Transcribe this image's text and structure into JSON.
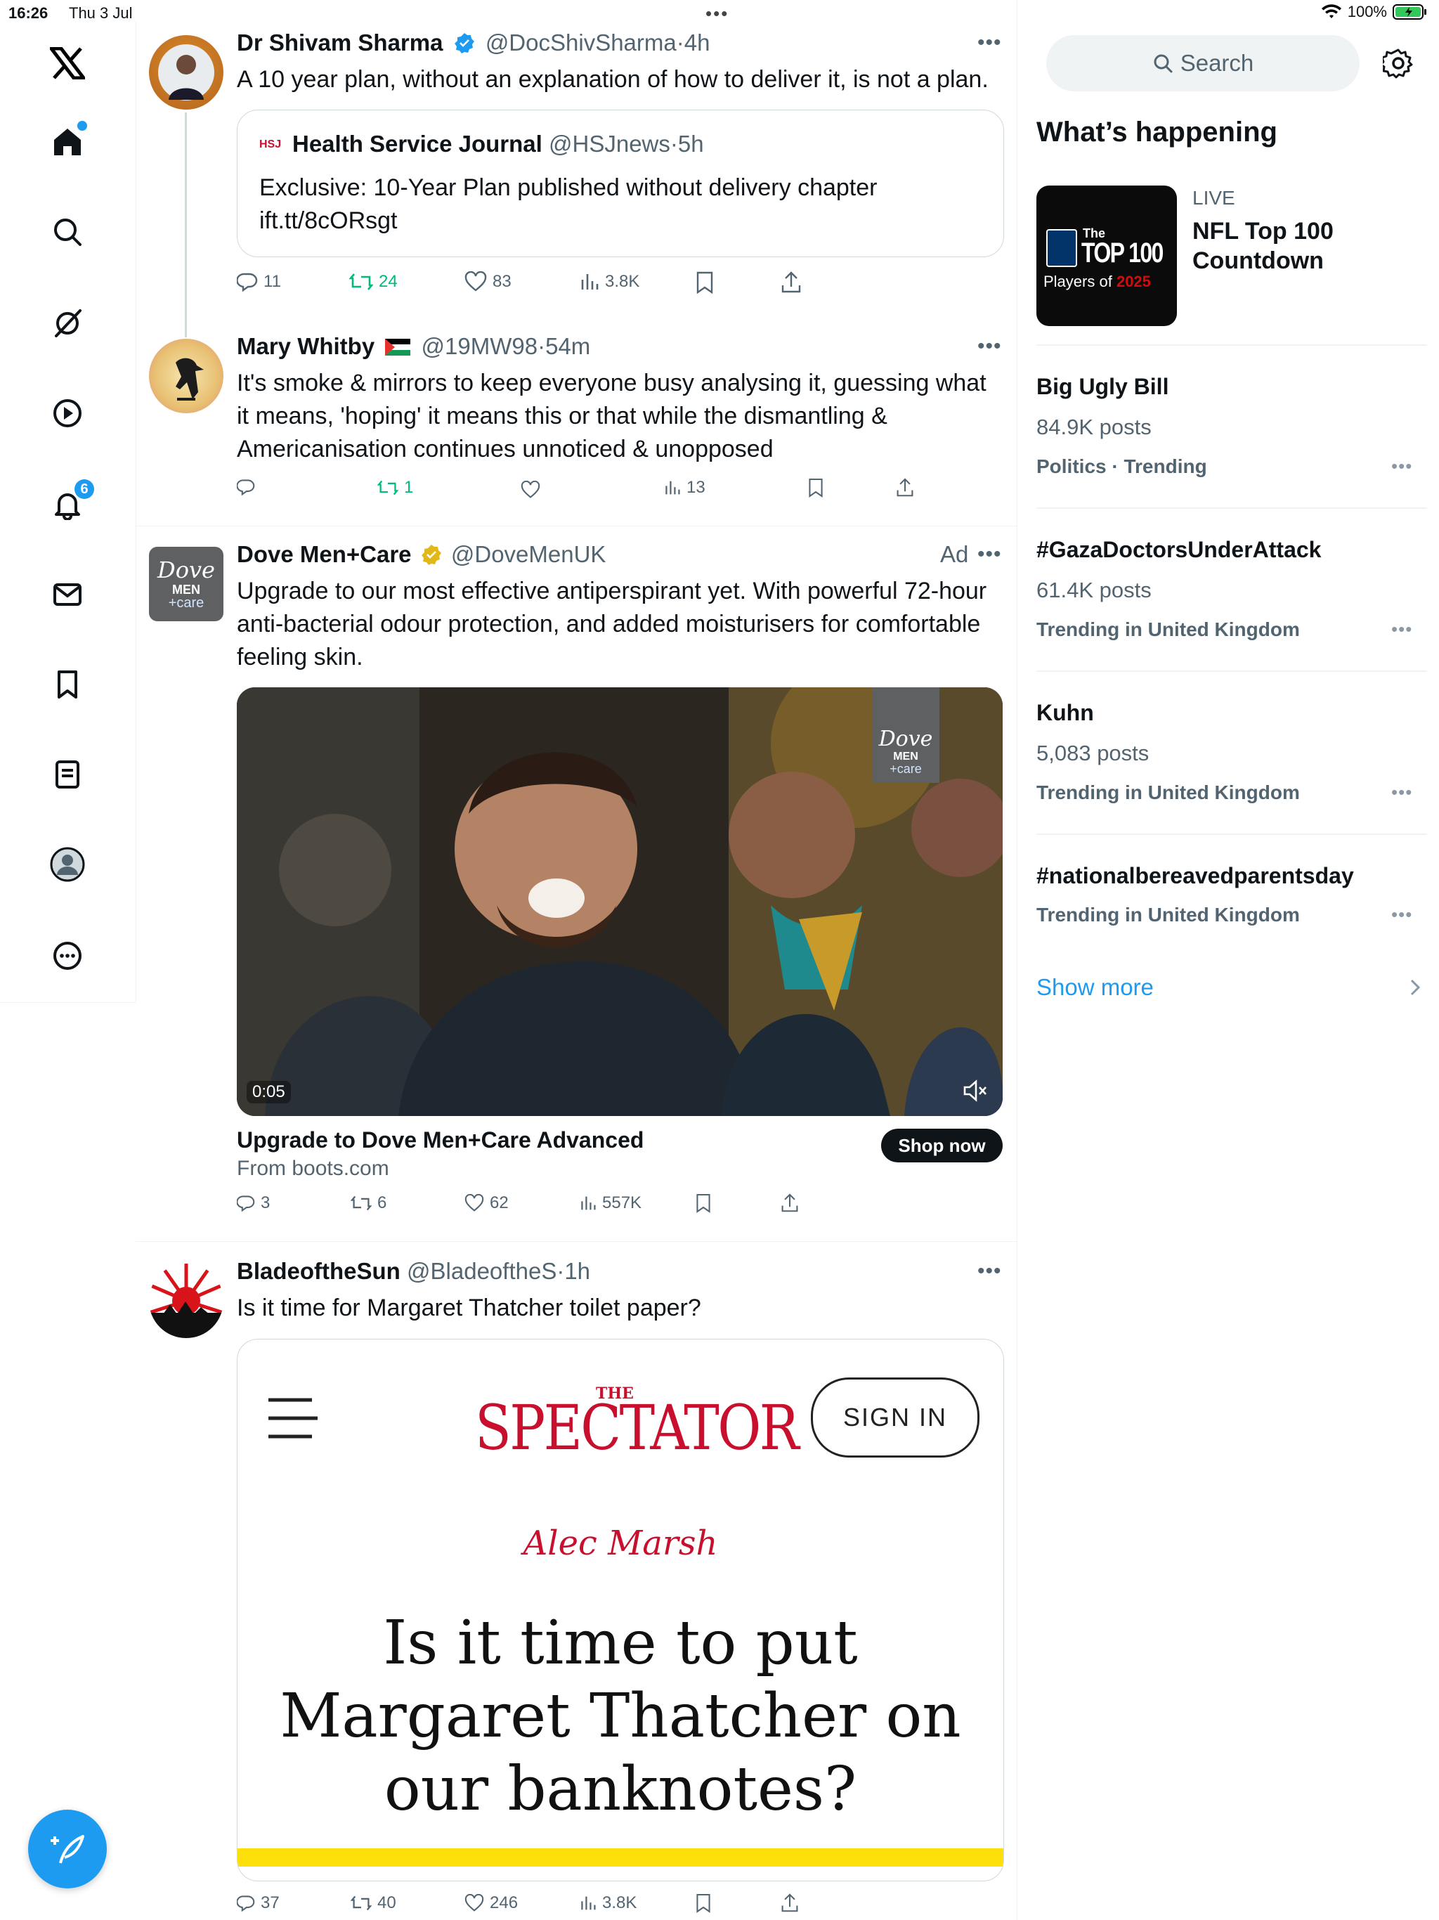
{
  "status_bar": {
    "time": "16:26",
    "date": "Thu 3 Jul",
    "battery": "100%"
  },
  "sidebar": {
    "notification_badge": "6"
  },
  "tweets": [
    {
      "name": "Dr Shivam Sharma",
      "handle": "@DocShivSharma",
      "time": "4h",
      "text": "A 10 year plan, without an explanation of how to deliver it, is not a plan.",
      "quote": {
        "logo": "HSJ",
        "name": "Health Service Journal",
        "handle": "@HSJnews",
        "time": "5h",
        "text": "Exclusive: 10-Year Plan published without delivery chapter ift.tt/8cORsgt"
      },
      "replies": "11",
      "reposts": "24",
      "likes": "83",
      "views": "3.8K"
    },
    {
      "name": "Mary Whitby",
      "handle": "@19MW98",
      "time": "54m",
      "text": "It's smoke & mirrors to keep everyone busy analysing it, guessing what it means, 'hoping' it means this or that while the dismantling & Americanisation continues unnoticed & unopposed",
      "replies": "",
      "reposts": "1",
      "likes": "",
      "views": "13"
    },
    {
      "name": "Dove Men+Care",
      "handle": "@DoveMenUK",
      "ad_label": "Ad",
      "avatar_text": {
        "line1": "Dove",
        "line2": "MEN",
        "line3": "+care"
      },
      "text": "Upgrade to our most effective antiperspirant yet. With powerful 72-hour anti-bacterial odour protection, and added moisturisers for comfortable feeling skin.",
      "video_time": "0:05",
      "card_title": "Upgrade to Dove Men+Care Advanced",
      "card_source": "From boots.com",
      "cta": "Shop now",
      "replies": "3",
      "reposts": "6",
      "likes": "62",
      "views": "557K"
    },
    {
      "name": "BladeoftheSun",
      "handle": "@BladeoftheS",
      "time": "1h",
      "text": "Is it time for Margaret Thatcher toilet paper?",
      "article": {
        "masthead_small": "THE",
        "masthead": "SPECTATOR",
        "sign_in": "SIGN IN",
        "author": "Alec Marsh",
        "headline_1": "Is it time to put",
        "headline_2": "Margaret Thatcher on",
        "headline_3": "our banknotes?"
      },
      "replies": "37",
      "reposts": "40",
      "likes": "246",
      "views": "3.8K"
    }
  ],
  "right": {
    "search_placeholder": "Search",
    "section_title": "What’s happening",
    "featured": {
      "live": "LIVE",
      "title": "NFL Top 100 Countdown",
      "thumb_small": "The",
      "thumb_big": "TOP 100",
      "thumb_sub": "Players of",
      "thumb_year": "2025"
    },
    "trends": [
      {
        "title": "Big Ugly Bill",
        "posts": "84.9K posts",
        "meta": "Politics · Trending"
      },
      {
        "title": "#GazaDoctorsUnderAttack",
        "posts": "61.4K posts",
        "meta": "Trending in United Kingdom"
      },
      {
        "title": "Kuhn",
        "posts": "5,083 posts",
        "meta": "Trending in United Kingdom"
      },
      {
        "title": "#nationalbereavedparentsday",
        "posts": "",
        "meta": "Trending in United Kingdom"
      }
    ],
    "show_more": "Show more"
  },
  "colors": {
    "accent": "#1d9bf0",
    "repost_green": "#00ba7c",
    "muted": "#536471",
    "spectator_red": "#c8102e"
  }
}
